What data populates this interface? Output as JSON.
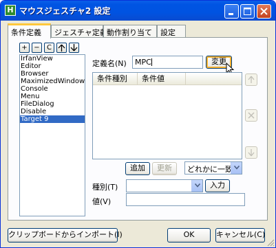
{
  "window": {
    "title": "マウスジェスチャ2 設定",
    "app_icon_letter": "H"
  },
  "tabs": [
    {
      "label": "条件定義",
      "active": true
    },
    {
      "label": "ジェスチャ定義",
      "active": false
    },
    {
      "label": "動作割り当て",
      "active": false
    },
    {
      "label": "設定",
      "active": false
    }
  ],
  "list_toolbar": {
    "add": "+",
    "remove": "−",
    "copy": "C",
    "up_icon": "arrow-up-icon",
    "down_icon": "arrow-down-icon"
  },
  "target_list": {
    "items": [
      "IrfanView",
      "Editor",
      "Browser",
      "MaximizedWindow",
      "Console",
      "Menu",
      "FileDialog",
      "Disable",
      "Target 9"
    ],
    "selected": "Target 9"
  },
  "definition_name": {
    "label": "定義名(N)",
    "value": "MPC",
    "change_button": "変更"
  },
  "conditions_table": {
    "columns": [
      "条件種別",
      "条件値"
    ]
  },
  "actions": {
    "add_button": "追加",
    "update_button": "更新",
    "match_mode": "どれかに一致"
  },
  "type_row": {
    "label": "種別(T)",
    "value": "",
    "input_button": "入力"
  },
  "value_row": {
    "label": "値(V)",
    "value": ""
  },
  "footer": {
    "import_button": "クリップボードからインポート(I)",
    "ok_button": "OK",
    "cancel_button": "キャンセル(C)"
  },
  "colors": {
    "titlebar": "#0054e3",
    "selection": "#316ac5",
    "tab_highlight": "#ffc83c"
  }
}
